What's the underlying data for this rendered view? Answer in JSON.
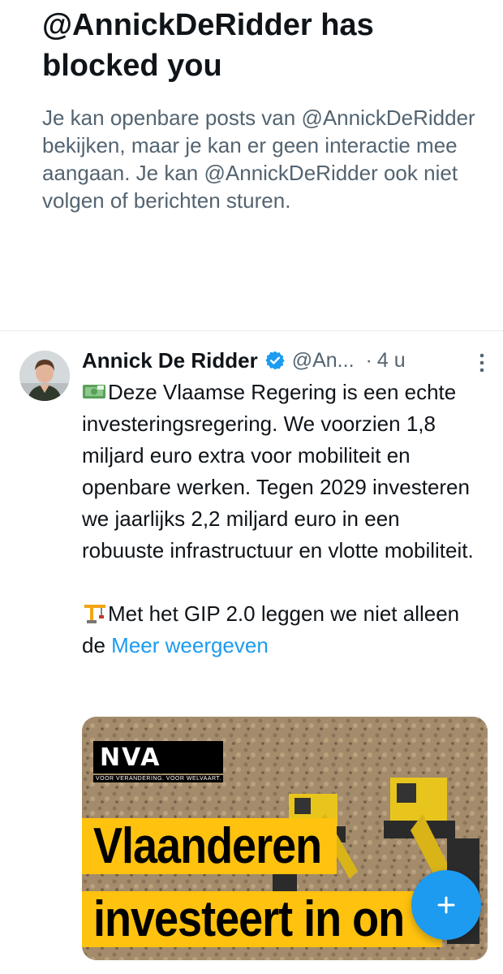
{
  "blocked": {
    "title": "@AnnickDeRidder has blocked you",
    "description": "Je kan openbare posts van @AnnickDeRidder bekijken, maar je kan er geen interactie mee aangaan. Je kan @AnnickDeRidder ook niet volgen of berichten sturen."
  },
  "tweet": {
    "author_name": "Annick De Ridder",
    "handle": "@An...",
    "separator": "·",
    "time": "4 u",
    "paragraph1": "Deze Vlaamse Regering is een echte investeringsregering. We voorzien 1,8 miljard euro extra voor mobiliteit en openbare werken. Tegen 2029 investeren we jaarlijks 2,2 miljard euro in een robuuste infrastructuur en vlotte mobiliteit.",
    "paragraph2": "Met het GIP 2.0 leggen we niet alleen de ",
    "show_more": "Meer weergeven",
    "icons": [
      "money-emoji-icon",
      "construction-crane-emoji-icon",
      "verified-badge-icon",
      "more-options-icon"
    ]
  },
  "media": {
    "logo_text": "NVA",
    "logo_subtext": "VOOR VERANDERING. VOOR WELVAART.",
    "headline_line1": "Vlaanderen",
    "headline_line2": "investeert in on"
  },
  "colors": {
    "accent": "#1d9bf0",
    "secondary_text": "#536471",
    "nva_yellow": "#ffc20e"
  }
}
